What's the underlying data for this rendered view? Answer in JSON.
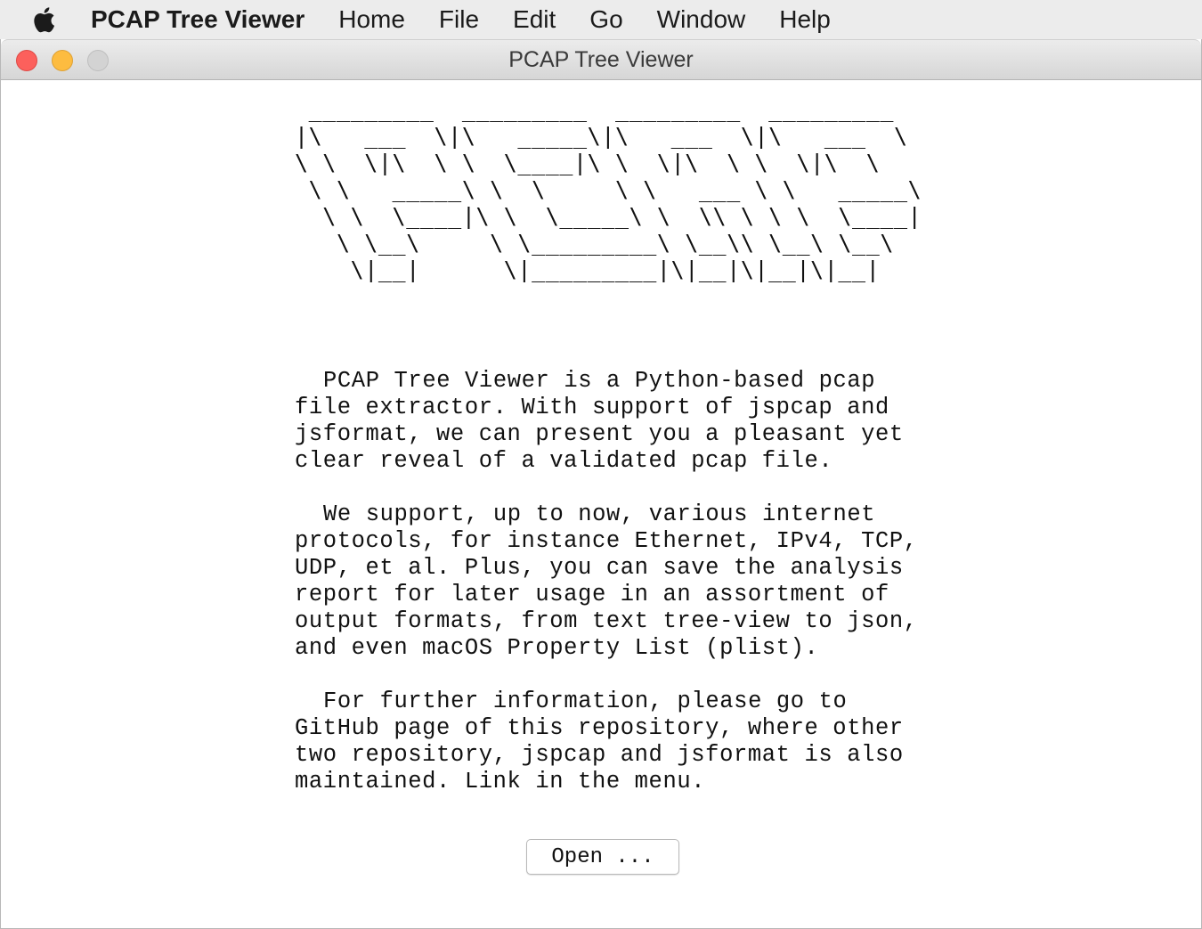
{
  "menubar": {
    "app_name": "PCAP Tree Viewer",
    "items": [
      "Home",
      "File",
      "Edit",
      "Go",
      "Window",
      "Help"
    ]
  },
  "window": {
    "title": "PCAP Tree Viewer",
    "logo_art": " _________  _________  _________  _________\n|\\   ___  \\|\\   _____\\|\\   ___  \\|\\   ___  \\\n\\ \\  \\|\\  \\ \\  \\____|\\ \\  \\|\\  \\ \\  \\|\\  \\\n \\ \\   _____\\ \\  \\     \\ \\   ___ \\ \\   _____\\\n  \\ \\  \\____|\\ \\  \\_____\\ \\  \\\\ \\ \\ \\  \\____|\n   \\ \\__\\     \\ \\_________\\ \\__\\\\ \\__\\ \\__\\\n    \\|__|      \\|_________|\\|__|\\|__|\\|__|",
    "paragraphs": [
      "PCAP Tree Viewer is a Python-based pcap\nfile extractor. With support of jspcap and\njsformat, we can present you a pleasant yet\nclear reveal of a validated pcap file.",
      "We support, up to now, various internet\nprotocols, for instance Ethernet, IPv4, TCP,\nUDP, et al. Plus, you can save the analysis\nreport for later usage in an assortment of\noutput formats, from text tree-view to json,\nand even macOS Property List (plist).",
      "For further information, please go to\nGitHub page of this repository, where other\ntwo repository, jspcap and jsformat is also\nmaintained. Link in the menu."
    ],
    "open_button_label": "Open ..."
  },
  "icons": {
    "apple": "apple-logo-icon",
    "close": "close-window-icon",
    "minimize": "minimize-window-icon",
    "zoom": "zoom-window-icon"
  },
  "colors": {
    "close": "#fc605c",
    "minimize": "#fdbc40",
    "zoom_disabled": "#d3d3d3",
    "menubar_bg": "#ececec"
  }
}
